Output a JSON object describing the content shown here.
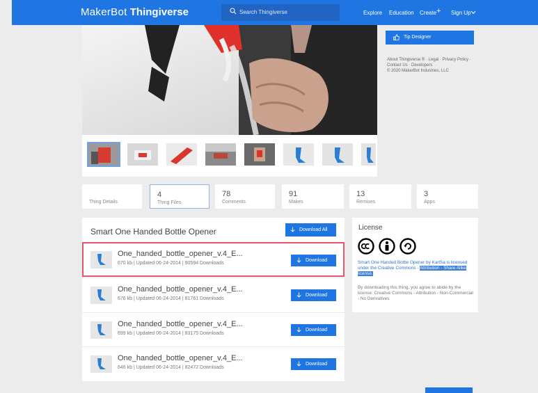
{
  "header": {
    "logo_prefix": "MakerBot",
    "logo_brand": "Thingiverse",
    "search_placeholder": "Search Thingiverse",
    "nav": [
      "Explore",
      "Education",
      "Create",
      "Sign Up"
    ]
  },
  "sidebar": {
    "tip_button": "Tip Designer",
    "links_line1": "About Thingiverse ® · Legal · Privacy Policy ·",
    "links_line2": "Contact Us · Developers",
    "copyright": "© 2020 MakerBot Industries, LLC"
  },
  "tabs": [
    {
      "count": "",
      "label": "Thing Details"
    },
    {
      "count": "4",
      "label": "Thing Files"
    },
    {
      "count": "78",
      "label": "Comments"
    },
    {
      "count": "91",
      "label": "Makes"
    },
    {
      "count": "13",
      "label": "Remixes"
    },
    {
      "count": "3",
      "label": "Apps"
    }
  ],
  "files": {
    "title": "Smart One Handed Bottle Opener",
    "download_all": "Download All",
    "download_label": "Download",
    "rows": [
      {
        "name": "One_handed_bottle_opener_v.4_E...",
        "meta": "670 kb | Updated 06-24-2014 | 90594 Downloads"
      },
      {
        "name": "One_handed_bottle_opener_v.4_E...",
        "meta": "676 kb | Updated 06-24-2014 | 81761 Downloads"
      },
      {
        "name": "One_handed_bottle_opener_v.4_E...",
        "meta": "699 kb | Updated 06-24-2014 | 83175 Downloads"
      },
      {
        "name": "One_handed_bottle_opener_v.4_E...",
        "meta": "646 kb | Updated 06-24-2014 | 82472 Downloads"
      }
    ]
  },
  "license": {
    "title": "License",
    "text_part1": "Smart One Handed Bottle Opener by KarlSa is licensed under the Creative Commons -",
    "text_highlight": "Attribution - Share Alike license.",
    "agree": "By downloading this thing, you agree to abide by the license: Creative Commons - Attribution - Non-Commercial - No Derivatives"
  },
  "colors": {
    "accent": "#1f76e3",
    "highlight_border": "#e2546f"
  }
}
